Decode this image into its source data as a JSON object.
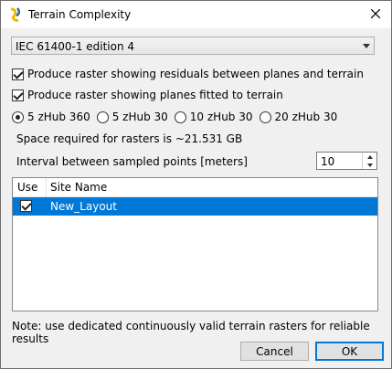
{
  "window": {
    "title": "Terrain Complexity",
    "app_icon": "yellow-blue-swirl-icon",
    "close_icon": "close-icon"
  },
  "standard_select": {
    "selected": "IEC 61400-1 edition 4"
  },
  "checkboxes": [
    {
      "label": "Produce raster showing residuals between planes and terrain",
      "checked": true
    },
    {
      "label": "Produce raster showing planes fitted to terrain",
      "checked": true
    }
  ],
  "radios": [
    {
      "label": "5 zHub 360",
      "checked": true
    },
    {
      "label": "5 zHub 30",
      "checked": false
    },
    {
      "label": "10 zHub 30",
      "checked": false
    },
    {
      "label": "20 zHub 30",
      "checked": false
    }
  ],
  "space_required": "Space required for rasters is ~21.531 GB",
  "interval": {
    "label": "Interval between sampled points [meters]",
    "value": "10"
  },
  "table": {
    "headers": [
      "Use",
      "Site Name"
    ],
    "rows": [
      {
        "use": true,
        "name": "New_Layout"
      }
    ],
    "selection_color": "#0078d7"
  },
  "note": "Note: use dedicated continuously valid terrain rasters for reliable results",
  "buttons": {
    "cancel": "Cancel",
    "ok": "OK"
  }
}
